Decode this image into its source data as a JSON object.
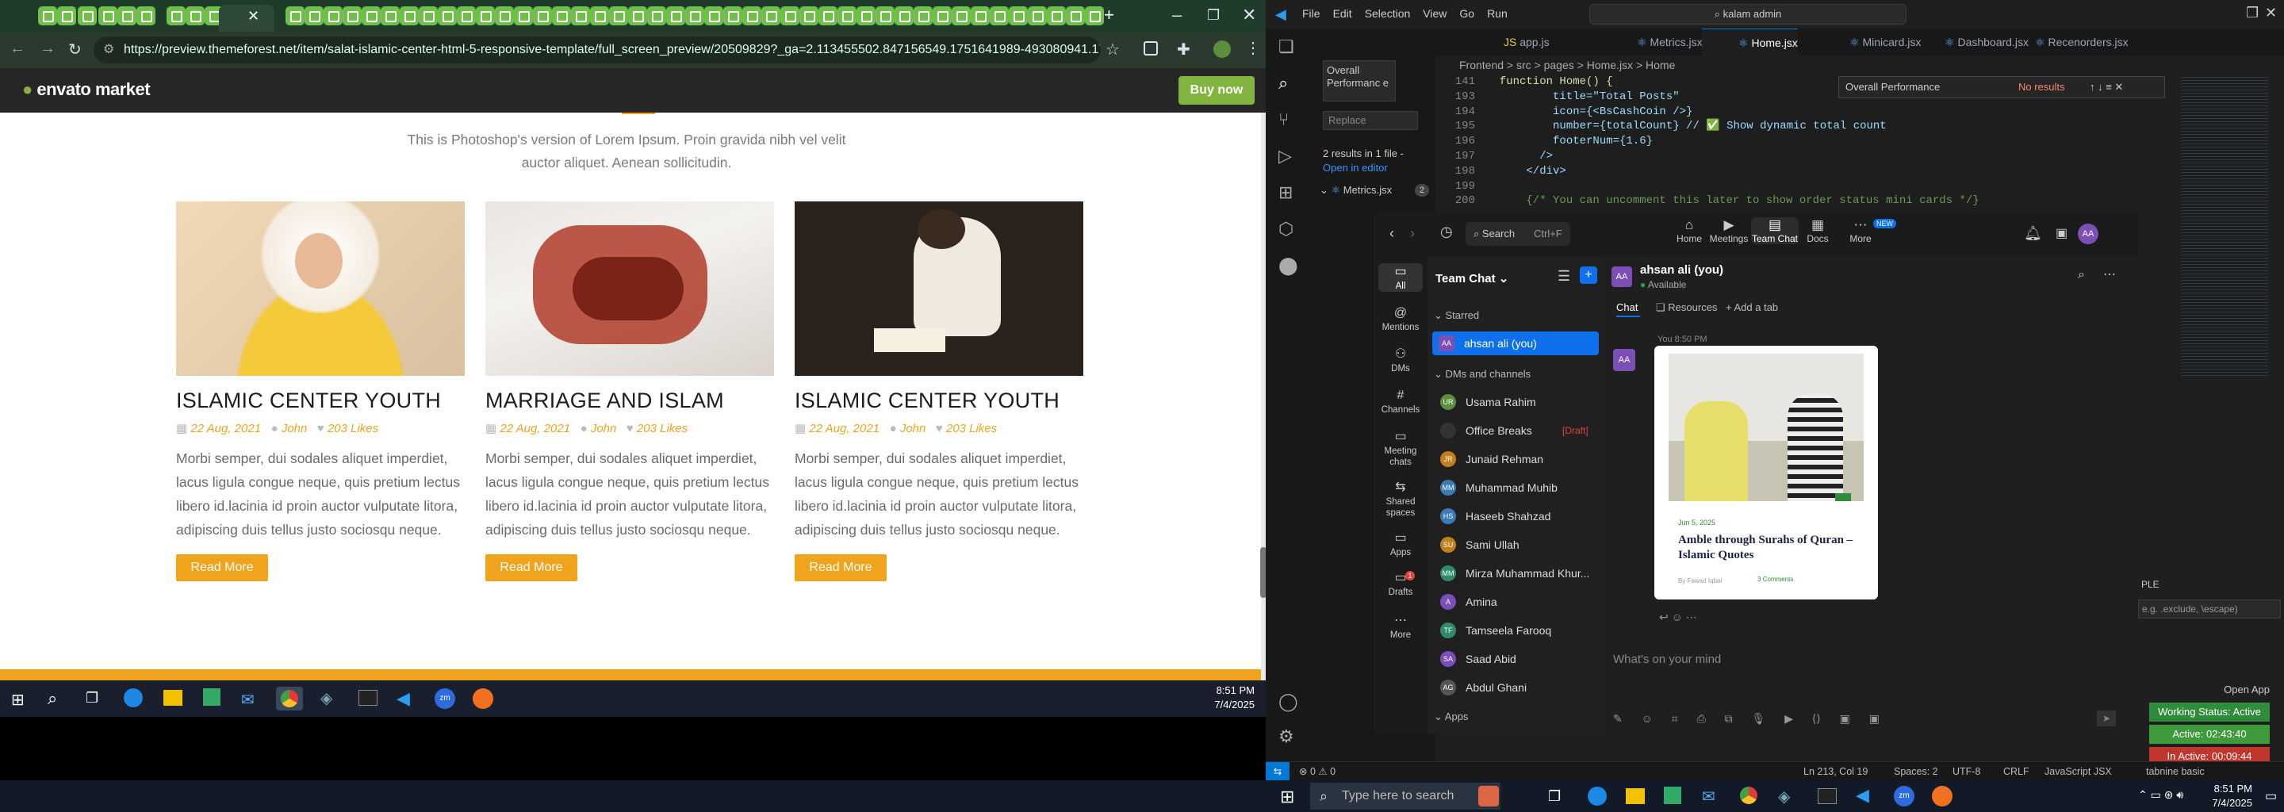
{
  "browser": {
    "url": "https://preview.themeforest.net/item/salat-islamic-center-html-5-responsive-template/full_screen_preview/20509829?_ga=2.113455502.847156549.1751641989-493080941.1751641989&_gac=1.61...",
    "envato_logo": "envato market",
    "buy_now": "Buy now",
    "intro": "This is Photoshop's version of Lorem Ipsum. Proin gravida nibh vel velit auctor aliquet. Aenean sollicitudin.",
    "cards": [
      {
        "title": "ISLAMIC CENTER YOUTH",
        "date": "22 Aug, 2021",
        "author": "John",
        "likes": "203 Likes",
        "body": "Morbi semper, dui sodales aliquet imperdiet, lacus ligula congue neque, quis pretium lectus libero id.lacinia id proin auctor vulputate litora, adipiscing duis tellus justo sociosqu neque.",
        "btn": "Read More"
      },
      {
        "title": "MARRIAGE AND ISLAM",
        "date": "22 Aug, 2021",
        "author": "John",
        "likes": "203 Likes",
        "body": "Morbi semper, dui sodales aliquet imperdiet, lacus ligula congue neque, quis pretium lectus libero id.lacinia id proin auctor vulputate litora, adipiscing duis tellus justo sociosqu neque.",
        "btn": "Read More"
      },
      {
        "title": "ISLAMIC CENTER YOUTH",
        "date": "22 Aug, 2021",
        "author": "John",
        "likes": "203 Likes",
        "body": "Morbi semper, dui sodales aliquet imperdiet, lacus ligula congue neque, quis pretium lectus libero id.lacinia id proin auctor vulputate litora, adipiscing duis tellus justo sociosqu neque.",
        "btn": "Read More"
      }
    ],
    "taskbar_time": "8:51 PM",
    "taskbar_date": "7/4/2025"
  },
  "vscode": {
    "menu": [
      "File",
      "Edit",
      "Selection",
      "View",
      "Go",
      "Run"
    ],
    "search_box": "kalam admin",
    "tabs": [
      "app.js",
      "Metrics.jsx",
      "Home.jsx",
      "Minicard.jsx",
      "Dashboard.jsx",
      "Recenorders.jsx"
    ],
    "active_tab": "Home.jsx",
    "breadcrumb": "Frontend > src > pages > Home.jsx > Home",
    "breadcrumb_fn": "function Home() {",
    "search_term": "Overall Performance",
    "search_term_wrapped": "Overall Performanc e",
    "replace_placeholder": "Replace",
    "results_summary": "2 results in 1 file -",
    "open_in_editor": "Open in editor",
    "result_file": "Metrics.jsx",
    "result_count": "2",
    "find_widget": {
      "value": "Overall Performance",
      "result": "No results"
    },
    "code_lines": [
      {
        "n": "141",
        "t": "  function Home() {"
      },
      {
        "n": "193",
        "t": "          title=\"Total Posts\""
      },
      {
        "n": "194",
        "t": "          icon={<BsCashCoin />}"
      },
      {
        "n": "195",
        "t": "          number={totalCount} // ✅ Show dynamic total count"
      },
      {
        "n": "196",
        "t": "          footerNum={1.6}"
      },
      {
        "n": "197",
        "t": "        />"
      },
      {
        "n": "198",
        "t": "      </div>"
      },
      {
        "n": "199",
        "t": ""
      },
      {
        "n": "200",
        "t": "      {/* You can uncomment this later to show order status mini cards */}"
      }
    ],
    "status": {
      "errors": "0",
      "warnings": "0",
      "position": "Ln 213, Col 19",
      "spaces": "Spaces: 2",
      "encoding": "UTF-8",
      "eol": "CRLF",
      "language": "JavaScript JSX",
      "tabnine": "tabnine basic"
    },
    "panel_input": "e.g. .exclude, \\escape)",
    "panel_label": "PLE",
    "open_app": "Open App",
    "working_status": "Working Status: Active",
    "active": "Active: 02:43:40",
    "inactive": "In Active: 00:09:44"
  },
  "teams": {
    "search": "Search",
    "search_shortcut": "Ctrl+F",
    "nav": [
      "Home",
      "Meetings",
      "Team Chat",
      "Docs",
      "More"
    ],
    "new_badge": "NEW",
    "rail": [
      "All",
      "Mentions",
      "DMs",
      "Channels",
      "Meeting chats",
      "Shared spaces",
      "Apps",
      "Drafts",
      "More"
    ],
    "drafts_badge": "1",
    "list_title": "Team Chat",
    "starred": "Starred",
    "me": "ahsan ali (you)",
    "dms_channels": "DMs and channels",
    "contacts": [
      {
        "name": "Usama Rahim",
        "init": "UR",
        "color": "#5a8f3c",
        "tag": ""
      },
      {
        "name": "Office Breaks",
        "init": "",
        "color": "#333",
        "tag": "[Draft]"
      },
      {
        "name": "Junaid Rehman",
        "init": "JR",
        "color": "#c08020",
        "tag": ""
      },
      {
        "name": "Muhammad Muhib",
        "init": "MM",
        "color": "#3a7bb5",
        "tag": ""
      },
      {
        "name": "Haseeb Shahzad",
        "init": "HS",
        "color": "#3a7bb5",
        "tag": ""
      },
      {
        "name": "Sami Ullah",
        "init": "SU",
        "color": "#c08020",
        "tag": ""
      },
      {
        "name": "Mirza Muhammad Khur...",
        "init": "MM",
        "color": "#2f8c6a",
        "tag": ""
      },
      {
        "name": "Amina",
        "init": "A",
        "color": "#7b4fb5",
        "tag": ""
      },
      {
        "name": "Tamseela Farooq",
        "init": "TF",
        "color": "#2f8c6a",
        "tag": ""
      },
      {
        "name": "Saad Abid",
        "init": "SA",
        "color": "#7b4fb5",
        "tag": ""
      },
      {
        "name": "Abdul Ghani",
        "init": "AG",
        "color": "#555",
        "tag": ""
      }
    ],
    "apps": "Apps",
    "chat_header_name": "ahsan ali (you)",
    "chat_status": "Available",
    "chat_tabs": [
      "Chat",
      "Resources",
      "Add a tab"
    ],
    "msg_time": "You 8:50 PM",
    "post_date": "Jun 5, 2025",
    "post_title": "Amble through Surahs of Quran – Islamic Quotes",
    "post_author": "By Fawad Iqbal",
    "post_comments": "3 Comments",
    "input_placeholder": "What's on your mind",
    "avatar": "AA"
  },
  "taskbar": {
    "search_placeholder": "Type here to search",
    "time": "8:51 PM",
    "date": "7/4/2025"
  }
}
